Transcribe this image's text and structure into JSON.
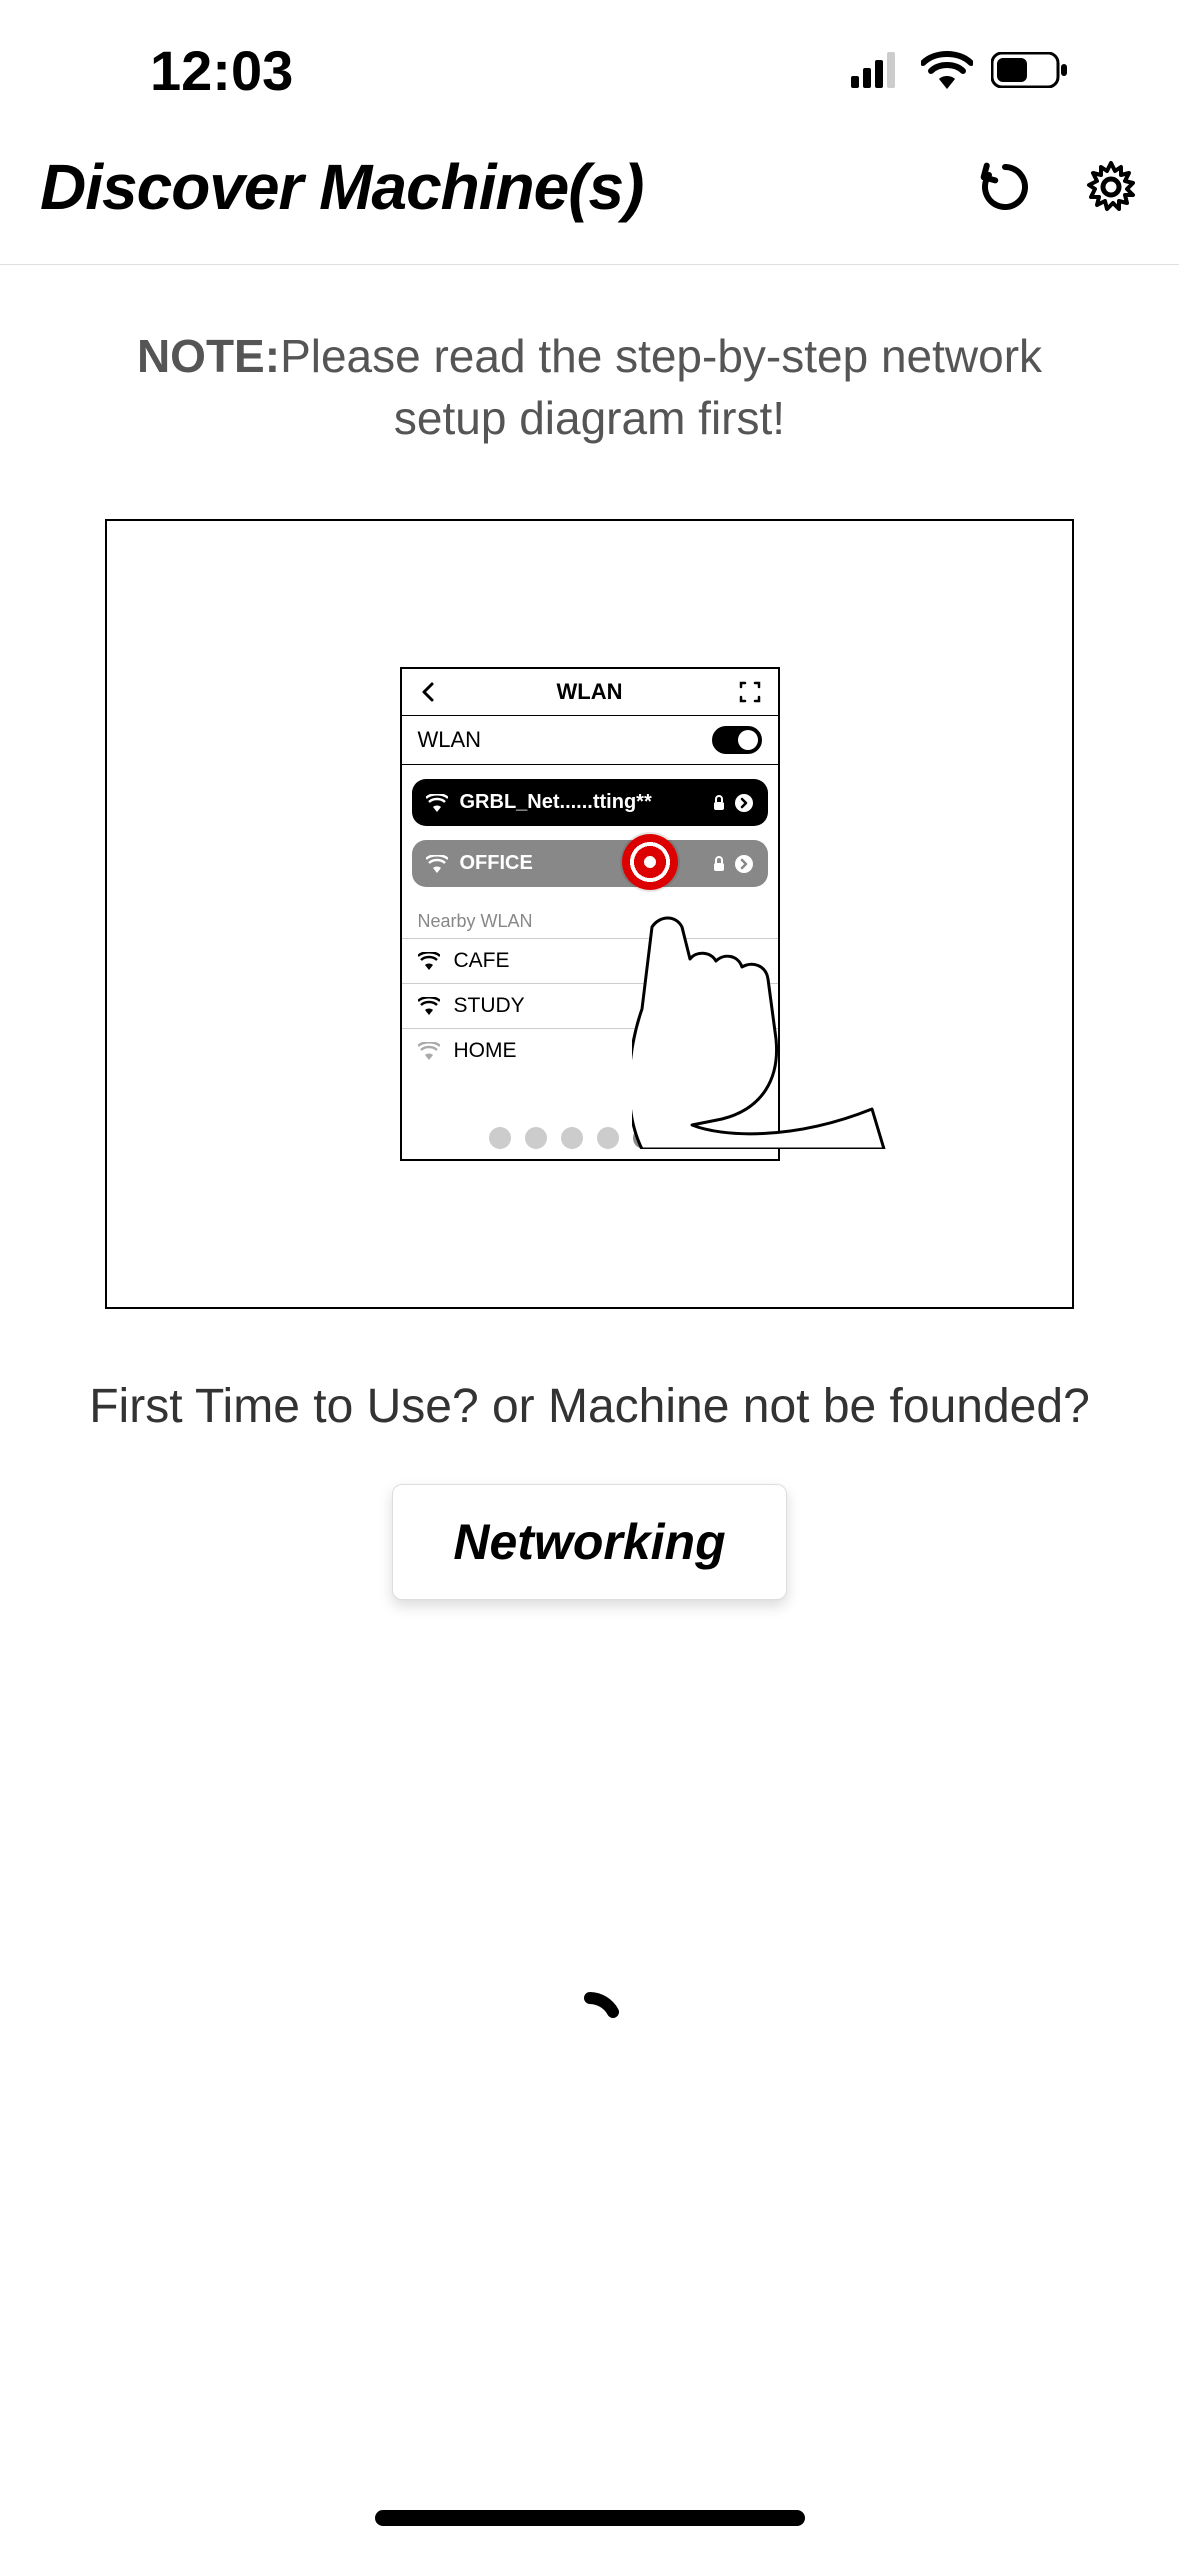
{
  "status": {
    "time": "12:03"
  },
  "header": {
    "title": "Discover Machine(s)"
  },
  "note": {
    "label": "NOTE:",
    "text": "Please read the step-by-step network setup diagram first!"
  },
  "diagram": {
    "mock_title": "WLAN",
    "wlan_label": "WLAN",
    "connected": "GRBL_Net......tting**",
    "selected": "OFFICE",
    "nearby_label": "Nearby WLAN",
    "nearby": [
      "CAFE",
      "STUDY",
      "HOME"
    ],
    "page_dots": {
      "count": 6,
      "active_index": 4
    }
  },
  "prompt": "First Time to Use? or Machine not be founded?",
  "button": {
    "label": "Networking"
  }
}
